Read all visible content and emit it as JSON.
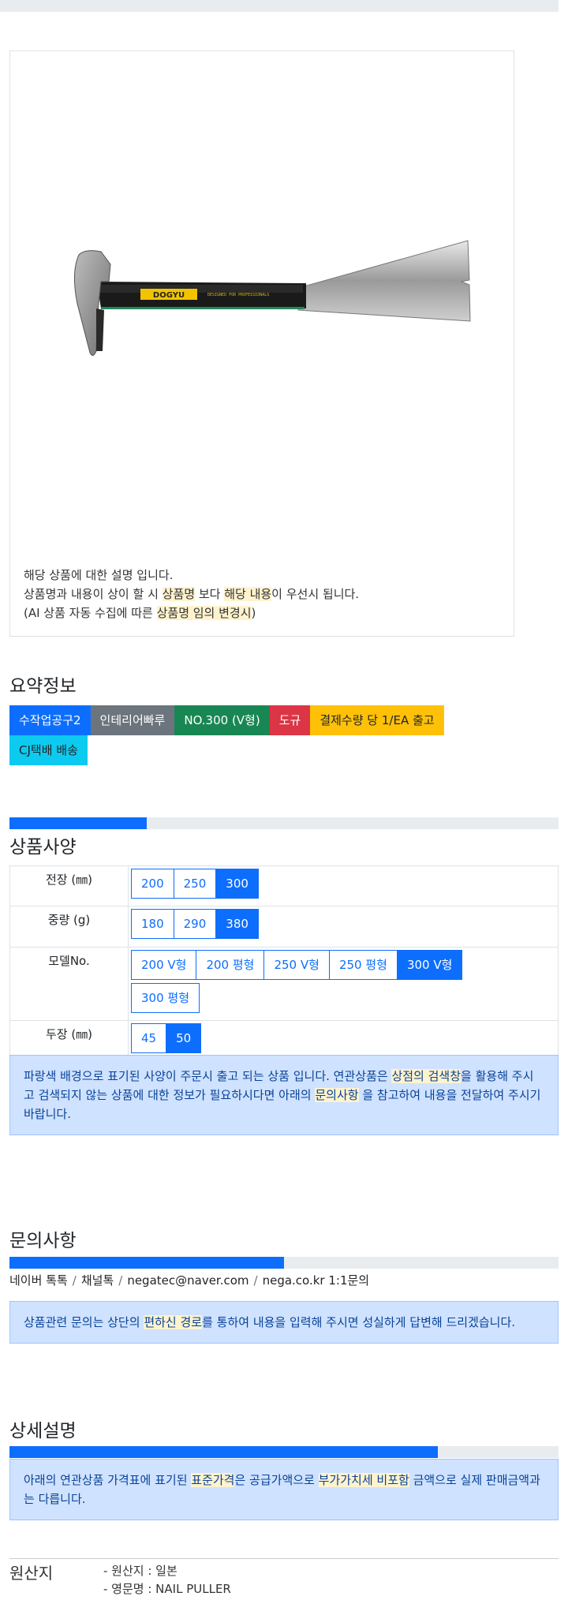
{
  "product": {
    "description_lines": [
      {
        "parts": [
          {
            "t": "해당 상품에 대한 설명 입니다.",
            "hl": false
          }
        ]
      },
      {
        "parts": [
          {
            "t": "상품명과 내용이 상이 할 시 ",
            "hl": false
          },
          {
            "t": "상품명",
            "hl": true
          },
          {
            "t": " 보다 ",
            "hl": false
          },
          {
            "t": "해당 내용",
            "hl": true
          },
          {
            "t": "이 우선시 됩니다.",
            "hl": false
          }
        ]
      },
      {
        "parts": [
          {
            "t": "(AI 상품 자동 수집에 따른 ",
            "hl": false
          },
          {
            "t": "상품명 임의 변경시",
            "hl": true
          },
          {
            "t": ")",
            "hl": false
          }
        ]
      }
    ],
    "image_brand_text": "DOGYU",
    "image_icon": "nail-puller-tool-icon"
  },
  "summary": {
    "title": "요약정보",
    "badges": [
      {
        "label": "수작업공구2",
        "color": "blue"
      },
      {
        "label": "인테리어빠루",
        "color": "gray"
      },
      {
        "label": "NO.300 (V형)",
        "color": "green"
      },
      {
        "label": "도규",
        "color": "red"
      },
      {
        "label": "결제수량 당 1/EA 출고",
        "color": "yellow"
      },
      {
        "label": "CJ택배 배송",
        "color": "cyan"
      }
    ],
    "progress": 0.25
  },
  "specs": {
    "title": "상품사양",
    "rows": [
      {
        "label": "전장 (㎜)",
        "options": [
          "200",
          "250",
          "300"
        ],
        "selected": "300"
      },
      {
        "label": "중량 (g)",
        "options": [
          "180",
          "290",
          "380"
        ],
        "selected": "380"
      },
      {
        "label": "모델No.",
        "options": [
          "200 V형",
          "200 평형",
          "250 V형",
          "250 평형",
          "300 V형",
          "300 평형"
        ],
        "selected": "300 V형"
      },
      {
        "label": "두장 (㎜)",
        "options": [
          "45",
          "50"
        ],
        "selected": "50"
      }
    ],
    "notice_parts": [
      {
        "t": "파랑색 배경으로 표기된 사양이 주문시 출고 되는 상품 입니다. 연관상품은 ",
        "hl": false
      },
      {
        "t": "상점의 검색창",
        "hl": true
      },
      {
        "t": "을 활용해 주시고 검색되지 않는 상품에 대한 정보가 필요하시다면 아래의 ",
        "hl": false
      },
      {
        "t": "문의사항",
        "hl": true
      },
      {
        "t": " 을 참고하여 내용을 전달하여 주시기 바랍니다.",
        "hl": false
      }
    ]
  },
  "inquiry": {
    "title": "문의사항",
    "progress": 0.5,
    "contacts": [
      "네이버 톡톡",
      "채널톡",
      "negatec@naver.com",
      "nega.co.kr 1:1문의"
    ],
    "separator": "/",
    "notice_parts": [
      {
        "t": "상품관련 문의는 상단의 ",
        "hl": false
      },
      {
        "t": "편하신 경로",
        "hl": true
      },
      {
        "t": "를 통하여 내용을 입력해 주시면 성실하게 답변해 드리겠습니다.",
        "hl": false
      }
    ]
  },
  "detail": {
    "title": "상세설명",
    "progress": 0.78,
    "notice_parts": [
      {
        "t": "아래의 연관상품 가격표에 표기된 ",
        "hl": false
      },
      {
        "t": "표준가격",
        "hl": true
      },
      {
        "t": "은 공급가액으로 ",
        "hl": false
      },
      {
        "t": "부가가치세 비포함",
        "hl": true
      },
      {
        "t": " 금액으로 실제 판매금액과는 다릅니다.",
        "hl": false
      }
    ]
  },
  "origin": {
    "title": "원산지",
    "items": [
      "- 원산지 : 일본",
      "- 영문명 : NAIL PULLER"
    ]
  },
  "colors": {
    "primary": "#0d6efd",
    "highlight": "#fff3cd",
    "alert_bg": "#cfe2ff"
  }
}
